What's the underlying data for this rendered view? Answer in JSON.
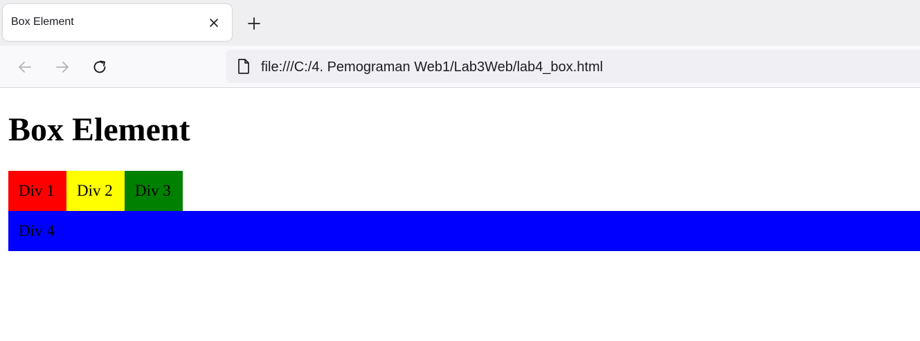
{
  "browser": {
    "tab": {
      "title": "Box Element",
      "close_icon": "close-icon"
    },
    "new_tab_icon": "plus-icon",
    "nav": {
      "back_icon": "arrow-left-icon",
      "forward_icon": "arrow-right-icon",
      "reload_icon": "reload-icon"
    },
    "address_bar": {
      "page_icon": "document-icon",
      "url": "file:///C:/4. Pemograman Web1/Lab3Web/lab4_box.html"
    }
  },
  "page": {
    "heading": "Box Element",
    "boxes": [
      {
        "label": "Div 1",
        "color": "#ff0000"
      },
      {
        "label": "Div 2",
        "color": "#ffff00"
      },
      {
        "label": "Div 3",
        "color": "#008000"
      },
      {
        "label": "Div 4",
        "color": "#0000ff"
      }
    ]
  },
  "colors": {
    "tabstrip_bg": "#efeff1",
    "navbar_bg": "#f9f9fb",
    "urlbar_bg": "#f0f0f4"
  }
}
